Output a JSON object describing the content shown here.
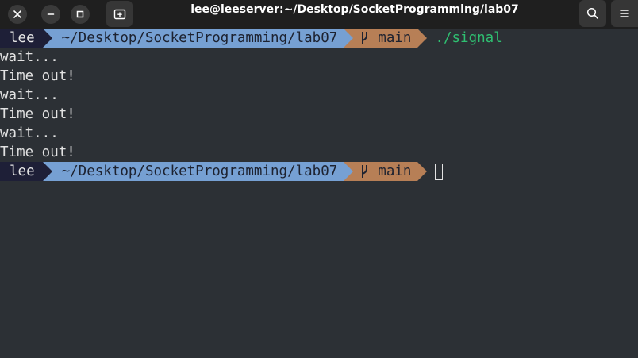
{
  "window": {
    "title": "lee@leeserver:~/Desktop/SocketProgramming/lab07",
    "buttons": [
      "close-icon",
      "minimize-icon",
      "maximize-icon",
      "new-tab-icon",
      "search-icon",
      "menu-icon"
    ]
  },
  "terminal": {
    "prompt1": {
      "user": "lee",
      "path": "~/Desktop/SocketProgramming/lab07",
      "branch": "main",
      "command": "./signal"
    },
    "output": [
      "wait...",
      "Time out!",
      "wait...",
      "Time out!",
      "wait...",
      "Time out!"
    ],
    "prompt2": {
      "user": "lee",
      "path": "~/Desktop/SocketProgramming/lab07",
      "branch": "main"
    }
  },
  "colors": {
    "background": "#2c3035",
    "user_segment": "#1e1f37",
    "path_segment": "#76a0d3",
    "git_segment": "#b77f56",
    "command": "#2fbf71",
    "titlebar": "#1f1f1f"
  }
}
